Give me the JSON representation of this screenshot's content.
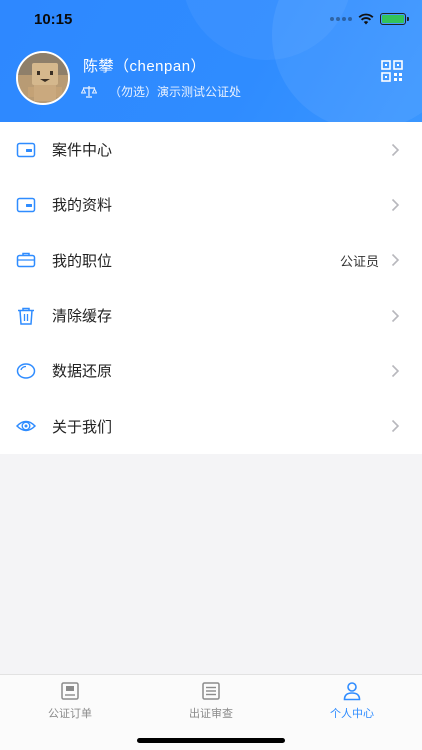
{
  "status_bar": {
    "time": "10:15"
  },
  "profile": {
    "name": "陈攀（chenpan）",
    "org": "（勿选）演示测试公证处"
  },
  "menu": {
    "items": [
      {
        "label": "案件中心",
        "value": "",
        "icon": "folder-card-icon"
      },
      {
        "label": "我的资料",
        "value": "",
        "icon": "id-card-icon"
      },
      {
        "label": "我的职位",
        "value": "公证员",
        "icon": "briefcase-icon"
      },
      {
        "label": "清除缓存",
        "value": "",
        "icon": "trash-icon"
      },
      {
        "label": "数据还原",
        "value": "",
        "icon": "restore-icon"
      },
      {
        "label": "关于我们",
        "value": "",
        "icon": "about-icon"
      }
    ]
  },
  "tabbar": {
    "tabs": [
      {
        "label": "公证订单",
        "icon": "order-icon",
        "active": false
      },
      {
        "label": "出证审查",
        "icon": "review-list-icon",
        "active": false
      },
      {
        "label": "个人中心",
        "icon": "person-icon",
        "active": true
      }
    ]
  },
  "colors": {
    "accent": "#2f8cff",
    "text": "#222222",
    "muted": "#8b8b8b"
  }
}
